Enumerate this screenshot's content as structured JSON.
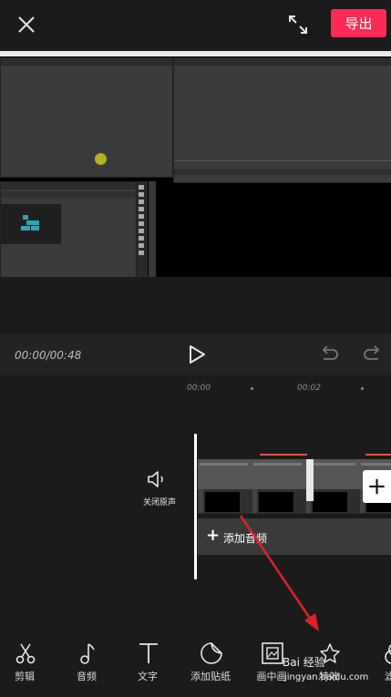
{
  "header": {
    "export_label": "导出"
  },
  "transport": {
    "time": "00:00/00:48"
  },
  "ruler": {
    "ticks": [
      "00:00",
      "00:02"
    ]
  },
  "track": {
    "mute_label": "关闭原声",
    "add_audio_label": "添加音频"
  },
  "toolbar": {
    "items": [
      {
        "label": "剪辑",
        "icon": "scissors-icon"
      },
      {
        "label": "音频",
        "icon": "music-note-icon"
      },
      {
        "label": "文字",
        "icon": "text-icon"
      },
      {
        "label": "添加贴纸",
        "icon": "sticker-icon"
      },
      {
        "label": "画中画",
        "icon": "picture-in-picture-icon"
      },
      {
        "label": "特效",
        "icon": "sparkle-star-icon"
      },
      {
        "label": "滤",
        "icon": "filter-icon"
      }
    ]
  },
  "watermark": {
    "line1": "Bai 经验",
    "line2": "jingyan.baidu.com"
  },
  "colors": {
    "accent": "#fc2b55",
    "annotation_arrow": "#e0202a",
    "playhead": "#ffffff"
  }
}
